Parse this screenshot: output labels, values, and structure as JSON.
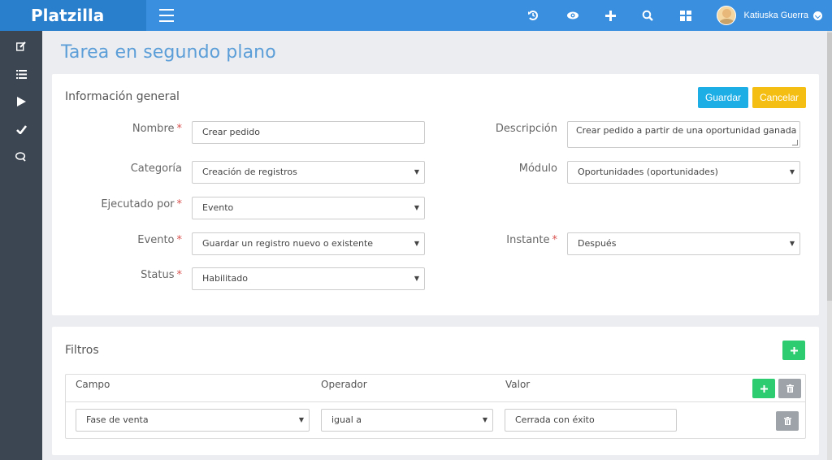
{
  "app": {
    "brand": "Platzilla",
    "user_name": "Katiuska Guerra"
  },
  "topbar_icons": [
    "history-icon",
    "eye-icon",
    "plus-icon",
    "search-icon",
    "grid-icon"
  ],
  "sidebar_icons": [
    "edit-icon",
    "list-icon",
    "play-icon",
    "check-icon",
    "chat-icon"
  ],
  "page": {
    "title": "Tarea en segundo plano"
  },
  "general": {
    "title": "Información general",
    "save_label": "Guardar",
    "cancel_label": "Cancelar",
    "fields": {
      "nombre": {
        "label": "Nombre",
        "value": "Crear pedido"
      },
      "descripcion": {
        "label": "Descripción",
        "value": "Crear pedido a partir de una oportunidad ganada"
      },
      "categoria": {
        "label": "Categoría",
        "value": "Creación de registros"
      },
      "modulo": {
        "label": "Módulo",
        "value": "Oportunidades (oportunidades)"
      },
      "ejecutado": {
        "label": "Ejecutado por",
        "value": "Evento"
      },
      "evento": {
        "label": "Evento",
        "value": "Guardar un registro nuevo o existente"
      },
      "instante": {
        "label": "Instante",
        "value": "Después"
      },
      "status": {
        "label": "Status",
        "value": "Habilitado"
      }
    },
    "required_mark": "*"
  },
  "filters": {
    "title": "Filtros",
    "columns": {
      "campo": "Campo",
      "operador": "Operador",
      "valor": "Valor"
    },
    "rows": [
      {
        "campo": "Fase de venta",
        "operador": "igual a",
        "valor": "Cerrada con éxito"
      }
    ]
  },
  "colors": {
    "topbar": "#3a8fdf",
    "sidebar": "#3c4652",
    "accent": "#1eaee6",
    "warning": "#f5be12",
    "success": "#2ecc71"
  }
}
